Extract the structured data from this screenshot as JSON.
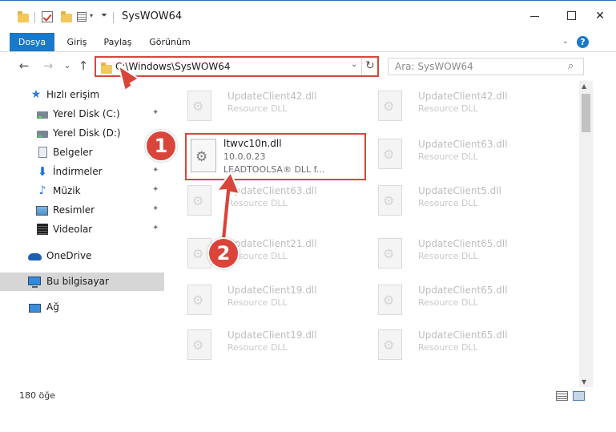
{
  "window": {
    "title": "SysWOW64",
    "minimize": "–",
    "maximize": "",
    "close": "✕"
  },
  "ribbon": {
    "tabs": [
      "Dosya",
      "Giriş",
      "Paylaş",
      "Görünüm"
    ],
    "help": "?"
  },
  "nav": {
    "back": "←",
    "forward": "→",
    "recent": "⌄",
    "up": "↑",
    "address": "C:\\Windows\\SysWOW64",
    "refresh": "↻",
    "search_placeholder": "Ara: SysWOW64",
    "search_icon": "⌕"
  },
  "sidebar": {
    "items": [
      {
        "label": "Hızlı erişim",
        "icon": "star-icon",
        "pinned": false
      },
      {
        "label": "Yerel Disk (C:)",
        "icon": "drive-icon",
        "pinned": true
      },
      {
        "label": "Yerel Disk (D:)",
        "icon": "drive-icon",
        "pinned": false
      },
      {
        "label": "Belgeler",
        "icon": "documents-icon",
        "pinned": true
      },
      {
        "label": "İndirmeler",
        "icon": "download-icon",
        "pinned": true
      },
      {
        "label": "Müzik",
        "icon": "music-icon",
        "pinned": true
      },
      {
        "label": "Resimler",
        "icon": "pictures-icon",
        "pinned": true
      },
      {
        "label": "Videolar",
        "icon": "videos-icon",
        "pinned": true
      },
      {
        "label": "OneDrive",
        "icon": "cloud-icon",
        "pinned": false
      },
      {
        "label": "Bu bilgisayar",
        "icon": "computer-icon",
        "pinned": false,
        "active": true
      },
      {
        "label": "Ağ",
        "icon": "network-icon",
        "pinned": false
      }
    ],
    "pin_glyph": "📌"
  },
  "files": {
    "left": [
      {
        "name": "UpdateClient42.dll",
        "type": "Resource DLL"
      },
      {
        "name": "UpdateClient63.dll",
        "type": "Resource DLL"
      },
      {
        "name": "UpdateClient21.dll",
        "type": "Resource DLL"
      },
      {
        "name": "UpdateClient19.dll",
        "type": "Resource DLL"
      },
      {
        "name": "UpdateClient19.dll",
        "type": "Resource DLL"
      }
    ],
    "right": [
      {
        "name": "UpdateClient42.dll",
        "type": "Resource DLL"
      },
      {
        "name": "UpdateClient63.dll",
        "type": "Resource DLL"
      },
      {
        "name": "UpdateClient5.dll",
        "type": "Resource DLL"
      },
      {
        "name": "UpdateClient65.dll",
        "type": "Resource DLL"
      },
      {
        "name": "UpdateClient65.dll",
        "type": "Resource DLL"
      },
      {
        "name": "UpdateClient65.dll",
        "type": "Resource DLL"
      }
    ],
    "highlighted": {
      "name": "ltwvc10n.dll",
      "version": "10.0.0.23",
      "company": "LEADTOOLSA® DLL f..."
    }
  },
  "annotations": {
    "badge_1": "1",
    "badge_2": "2",
    "color": "#d9453b"
  },
  "scrollbar": {
    "up": "▲",
    "down": "▼"
  },
  "status": {
    "item_count": "180 öğe"
  }
}
